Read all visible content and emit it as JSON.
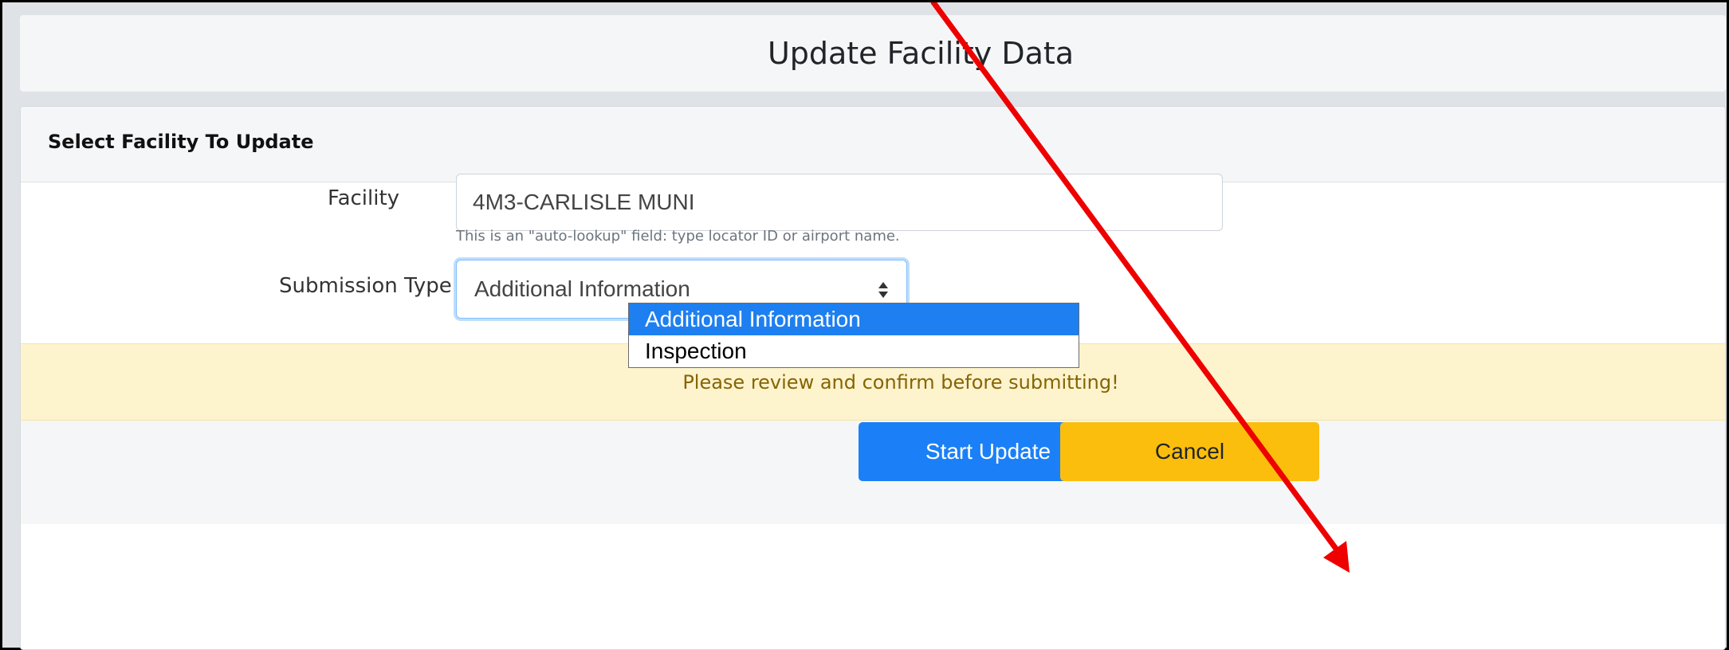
{
  "header": {
    "title": "Update Facility Data"
  },
  "card": {
    "title": "Select Facility To Update"
  },
  "form": {
    "facility": {
      "label": "Facility",
      "value": "4M3-CARLISLE MUNI",
      "help": "This is an \"auto-lookup\" field: type locator ID or airport name."
    },
    "submission_type": {
      "label": "Submission Type",
      "selected": "Additional Information",
      "options": [
        "Additional Information",
        "Inspection"
      ],
      "highlighted_option": "Additional Information"
    }
  },
  "alert": {
    "text": "Please review and confirm before submitting!"
  },
  "footer": {
    "start_label": "Start Update",
    "cancel_label": "Cancel"
  },
  "colors": {
    "primary": "#1b80f7",
    "warning": "#fbbe0d",
    "alert_bg": "#fdf3cd",
    "annotation_arrow": "#ee0000"
  },
  "icons": {
    "select_caret": "updown-caret-icon",
    "annotation": "red-arrow-icon"
  }
}
